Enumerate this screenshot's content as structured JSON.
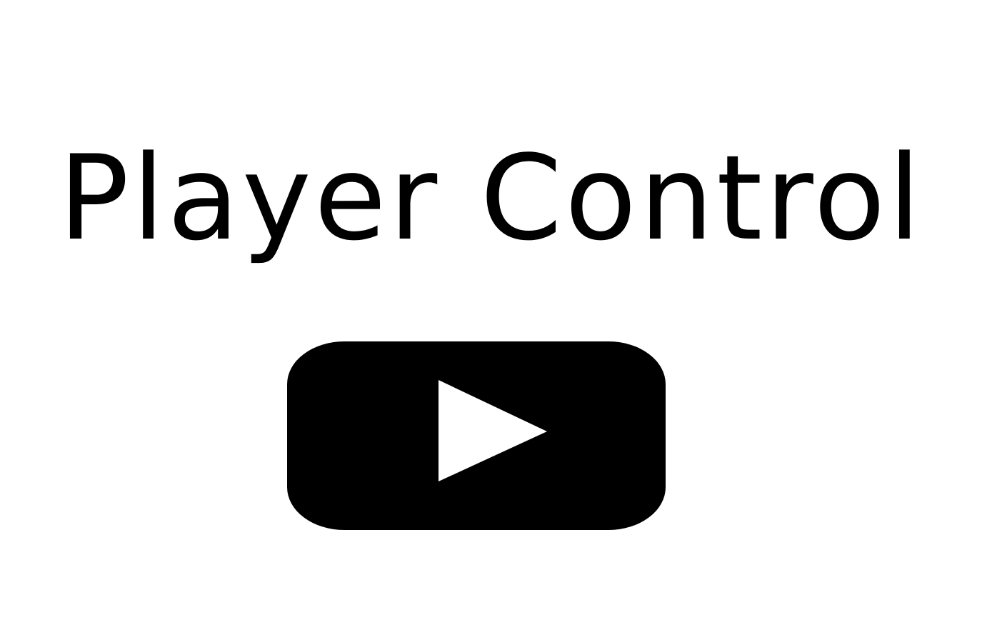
{
  "title": "Player Control",
  "play_button": {
    "icon": "play-icon",
    "color": "#000000",
    "icon_color": "#ffffff"
  }
}
